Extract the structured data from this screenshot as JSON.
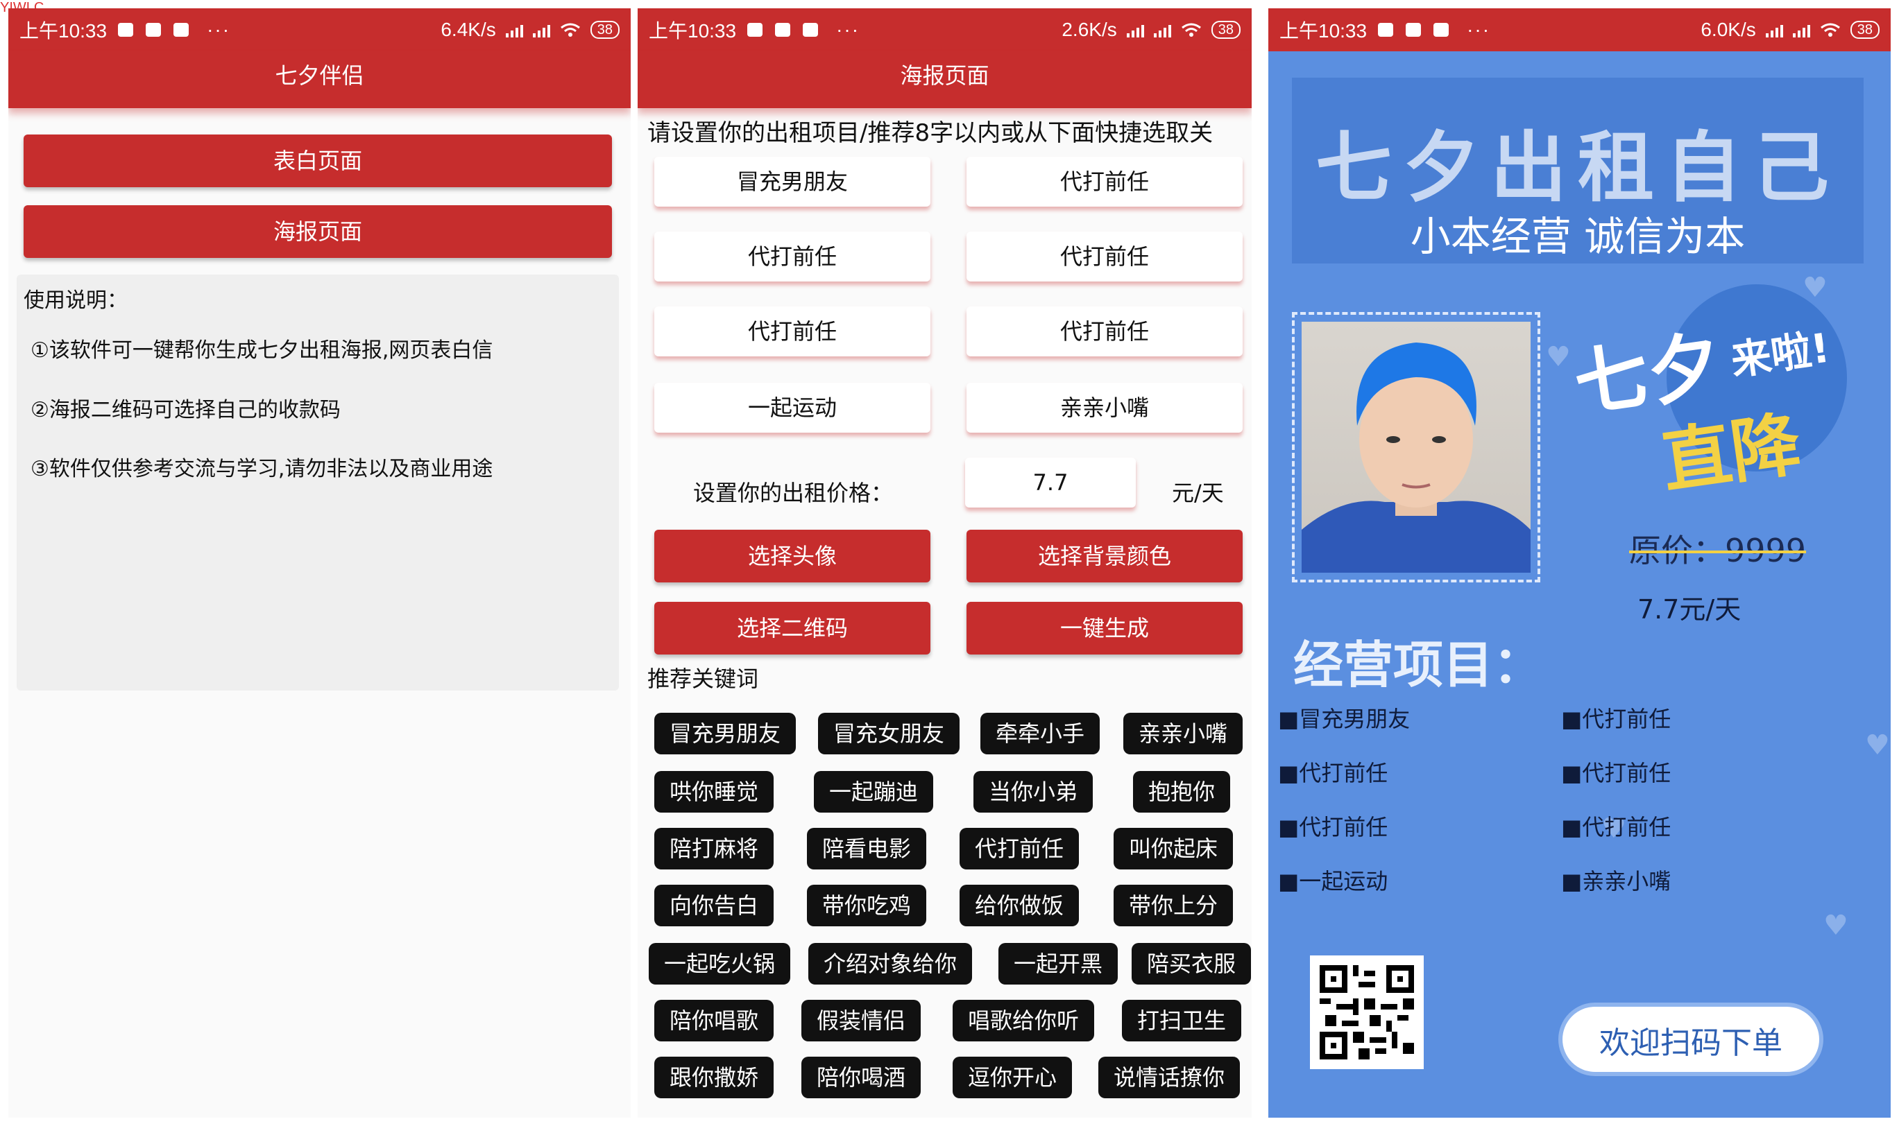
{
  "watermark": "YIWLC",
  "panels": [
    {
      "status": {
        "time": "上午10:33",
        "speed": "6.4K/s",
        "battery": "38"
      },
      "title": "七夕伴侣",
      "buttons": [
        "表白页面",
        "海报页面"
      ],
      "usage": {
        "title": "使用说明：",
        "lines": [
          "①该软件可一键帮你生成七夕出租海报,网页表白信",
          "②海报二维码可选择自己的收款码",
          "③软件仅供参考交流与学习,请勿非法以及商业用途"
        ]
      }
    },
    {
      "status": {
        "time": "上午10:33",
        "speed": "2.6K/s",
        "battery": "38"
      },
      "title": "海报页面",
      "prompt": "请设置你的出租项目/推荐8字以内或从下面快捷选取关",
      "items": [
        "冒充男朋友",
        "代打前任",
        "代打前任",
        "代打前任",
        "代打前任",
        "代打前任",
        "一起运动",
        "亲亲小嘴"
      ],
      "price_label": "设置你的出租价格：",
      "price_value": "7.7",
      "price_unit": "元/天",
      "actions": [
        "选择头像",
        "选择背景颜色",
        "选择二维码",
        "一键生成"
      ],
      "keywords_title": "推荐关键词",
      "keywords": [
        [
          "冒充男朋友",
          "冒充女朋友",
          "牵牵小手",
          "亲亲小嘴"
        ],
        [
          "哄你睡觉",
          "一起蹦迪",
          "当你小弟",
          "抱抱你"
        ],
        [
          "陪打麻将",
          "陪看电影",
          "代打前任",
          "叫你起床"
        ],
        [
          "向你告白",
          "带你吃鸡",
          "给你做饭",
          "带你上分"
        ],
        [
          "一起吃火锅",
          "介绍对象给你",
          "一起开黑",
          "陪买衣服"
        ],
        [
          "陪你唱歌",
          "假装情侣",
          "唱歌给你听",
          "打扫卫生"
        ],
        [
          "跟你撒娇",
          "陪你喝酒",
          "逗你开心",
          "说情话撩你"
        ]
      ]
    },
    {
      "status": {
        "time": "上午10:33",
        "speed": "6.0K/s",
        "battery": "38"
      },
      "header_title": "七夕出租自己",
      "header_subtitle": "小本经营 诚信为本",
      "promo_1": "七夕",
      "promo_2": "来啦!",
      "promo_3": "直降",
      "original_price": "原价：9999",
      "current_price": "7.7元/天",
      "items_title": "经营项目：",
      "items": [
        "■冒充男朋友",
        "■代打前任",
        "■代打前任",
        "■代打前任",
        "■代打前任",
        "■代打前任",
        "■一起运动",
        "■亲亲小嘴"
      ],
      "welcome": "欢迎扫码下单"
    }
  ],
  "colors": {
    "primary_red": "#c62d2d",
    "poster_blue": "#5b8fe0",
    "chip_black": "#111111",
    "accent_yellow": "#f3d144"
  }
}
